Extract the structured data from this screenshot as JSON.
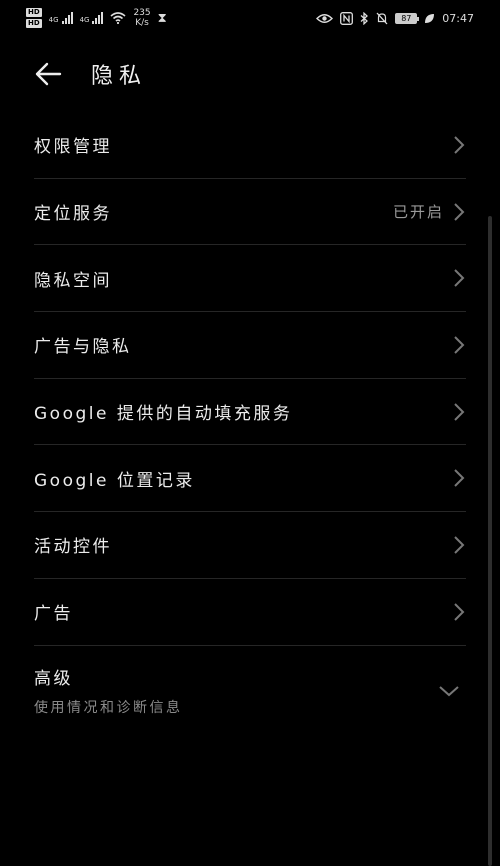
{
  "status_bar": {
    "hd1": "HD",
    "hd2": "HD",
    "net1": "4G",
    "net2": "4G",
    "speed_value": "235",
    "speed_unit": "K/s",
    "battery": "87",
    "time": "07:47"
  },
  "header": {
    "title": "隐私"
  },
  "list": {
    "items": [
      {
        "label": "权限管理",
        "value": ""
      },
      {
        "label": "定位服务",
        "value": "已开启"
      },
      {
        "label": "隐私空间",
        "value": ""
      },
      {
        "label": "广告与隐私",
        "value": ""
      },
      {
        "label": "Google 提供的自动填充服务",
        "value": ""
      },
      {
        "label": "Google 位置记录",
        "value": ""
      },
      {
        "label": "活动控件",
        "value": ""
      },
      {
        "label": "广告",
        "value": ""
      }
    ],
    "advanced": {
      "label": "高级",
      "subtitle": "使用情况和诊断信息"
    }
  },
  "icons": {
    "back": "arrow-left-icon",
    "chevron": "chevron-right-icon",
    "expand": "chevron-down-icon"
  },
  "colors": {
    "background": "#000000",
    "text": "#ececec",
    "secondary_text": "#9a9a9a",
    "divider": "#262626"
  }
}
